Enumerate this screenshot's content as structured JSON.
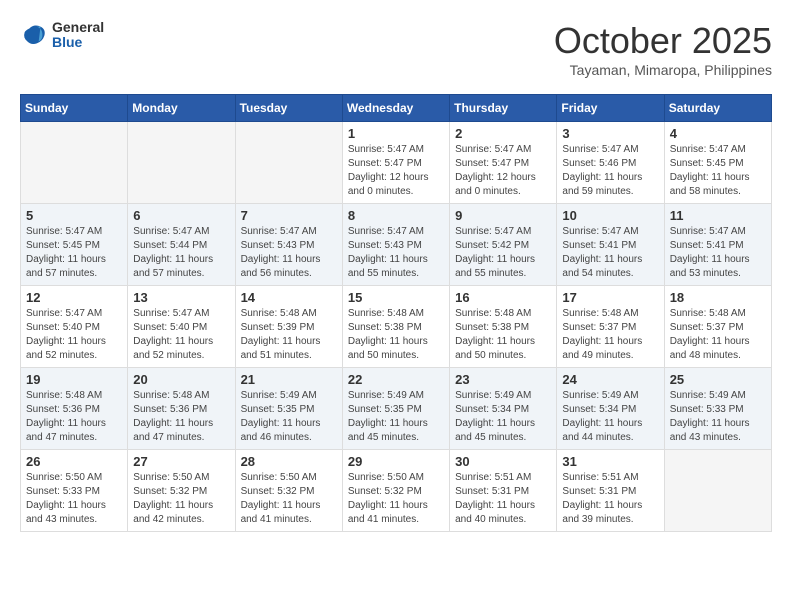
{
  "header": {
    "logo_general": "General",
    "logo_blue": "Blue",
    "month_title": "October 2025",
    "subtitle": "Tayaman, Mimaropa, Philippines"
  },
  "days_of_week": [
    "Sunday",
    "Monday",
    "Tuesday",
    "Wednesday",
    "Thursday",
    "Friday",
    "Saturday"
  ],
  "weeks": [
    [
      {
        "day": "",
        "info": ""
      },
      {
        "day": "",
        "info": ""
      },
      {
        "day": "",
        "info": ""
      },
      {
        "day": "1",
        "info": "Sunrise: 5:47 AM\nSunset: 5:47 PM\nDaylight: 12 hours\nand 0 minutes."
      },
      {
        "day": "2",
        "info": "Sunrise: 5:47 AM\nSunset: 5:47 PM\nDaylight: 12 hours\nand 0 minutes."
      },
      {
        "day": "3",
        "info": "Sunrise: 5:47 AM\nSunset: 5:46 PM\nDaylight: 11 hours\nand 59 minutes."
      },
      {
        "day": "4",
        "info": "Sunrise: 5:47 AM\nSunset: 5:45 PM\nDaylight: 11 hours\nand 58 minutes."
      }
    ],
    [
      {
        "day": "5",
        "info": "Sunrise: 5:47 AM\nSunset: 5:45 PM\nDaylight: 11 hours\nand 57 minutes."
      },
      {
        "day": "6",
        "info": "Sunrise: 5:47 AM\nSunset: 5:44 PM\nDaylight: 11 hours\nand 57 minutes."
      },
      {
        "day": "7",
        "info": "Sunrise: 5:47 AM\nSunset: 5:43 PM\nDaylight: 11 hours\nand 56 minutes."
      },
      {
        "day": "8",
        "info": "Sunrise: 5:47 AM\nSunset: 5:43 PM\nDaylight: 11 hours\nand 55 minutes."
      },
      {
        "day": "9",
        "info": "Sunrise: 5:47 AM\nSunset: 5:42 PM\nDaylight: 11 hours\nand 55 minutes."
      },
      {
        "day": "10",
        "info": "Sunrise: 5:47 AM\nSunset: 5:41 PM\nDaylight: 11 hours\nand 54 minutes."
      },
      {
        "day": "11",
        "info": "Sunrise: 5:47 AM\nSunset: 5:41 PM\nDaylight: 11 hours\nand 53 minutes."
      }
    ],
    [
      {
        "day": "12",
        "info": "Sunrise: 5:47 AM\nSunset: 5:40 PM\nDaylight: 11 hours\nand 52 minutes."
      },
      {
        "day": "13",
        "info": "Sunrise: 5:47 AM\nSunset: 5:40 PM\nDaylight: 11 hours\nand 52 minutes."
      },
      {
        "day": "14",
        "info": "Sunrise: 5:48 AM\nSunset: 5:39 PM\nDaylight: 11 hours\nand 51 minutes."
      },
      {
        "day": "15",
        "info": "Sunrise: 5:48 AM\nSunset: 5:38 PM\nDaylight: 11 hours\nand 50 minutes."
      },
      {
        "day": "16",
        "info": "Sunrise: 5:48 AM\nSunset: 5:38 PM\nDaylight: 11 hours\nand 50 minutes."
      },
      {
        "day": "17",
        "info": "Sunrise: 5:48 AM\nSunset: 5:37 PM\nDaylight: 11 hours\nand 49 minutes."
      },
      {
        "day": "18",
        "info": "Sunrise: 5:48 AM\nSunset: 5:37 PM\nDaylight: 11 hours\nand 48 minutes."
      }
    ],
    [
      {
        "day": "19",
        "info": "Sunrise: 5:48 AM\nSunset: 5:36 PM\nDaylight: 11 hours\nand 47 minutes."
      },
      {
        "day": "20",
        "info": "Sunrise: 5:48 AM\nSunset: 5:36 PM\nDaylight: 11 hours\nand 47 minutes."
      },
      {
        "day": "21",
        "info": "Sunrise: 5:49 AM\nSunset: 5:35 PM\nDaylight: 11 hours\nand 46 minutes."
      },
      {
        "day": "22",
        "info": "Sunrise: 5:49 AM\nSunset: 5:35 PM\nDaylight: 11 hours\nand 45 minutes."
      },
      {
        "day": "23",
        "info": "Sunrise: 5:49 AM\nSunset: 5:34 PM\nDaylight: 11 hours\nand 45 minutes."
      },
      {
        "day": "24",
        "info": "Sunrise: 5:49 AM\nSunset: 5:34 PM\nDaylight: 11 hours\nand 44 minutes."
      },
      {
        "day": "25",
        "info": "Sunrise: 5:49 AM\nSunset: 5:33 PM\nDaylight: 11 hours\nand 43 minutes."
      }
    ],
    [
      {
        "day": "26",
        "info": "Sunrise: 5:50 AM\nSunset: 5:33 PM\nDaylight: 11 hours\nand 43 minutes."
      },
      {
        "day": "27",
        "info": "Sunrise: 5:50 AM\nSunset: 5:32 PM\nDaylight: 11 hours\nand 42 minutes."
      },
      {
        "day": "28",
        "info": "Sunrise: 5:50 AM\nSunset: 5:32 PM\nDaylight: 11 hours\nand 41 minutes."
      },
      {
        "day": "29",
        "info": "Sunrise: 5:50 AM\nSunset: 5:32 PM\nDaylight: 11 hours\nand 41 minutes."
      },
      {
        "day": "30",
        "info": "Sunrise: 5:51 AM\nSunset: 5:31 PM\nDaylight: 11 hours\nand 40 minutes."
      },
      {
        "day": "31",
        "info": "Sunrise: 5:51 AM\nSunset: 5:31 PM\nDaylight: 11 hours\nand 39 minutes."
      },
      {
        "day": "",
        "info": ""
      }
    ]
  ]
}
